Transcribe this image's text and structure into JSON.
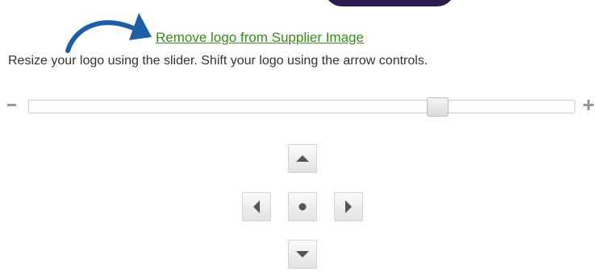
{
  "logo_editor": {
    "remove_link_label": "Remove logo from Supplier Image",
    "instructions": "Resize your logo using the slider. Shift your logo using the arrow controls."
  },
  "slider": {
    "value_percent": 75,
    "minus_icon": "minus-icon",
    "plus_icon": "plus-icon"
  },
  "arrow_controls": {
    "up_icon": "triangle-up-icon",
    "left_icon": "triangle-left-icon",
    "center_icon": "center-dot-icon",
    "right_icon": "triangle-right-icon",
    "down_icon": "triangle-down-icon"
  },
  "colors": {
    "link": "#3a8a1f",
    "pointer_arrow": "#1d5fa5",
    "logo_bg": "#2a1d4e"
  }
}
